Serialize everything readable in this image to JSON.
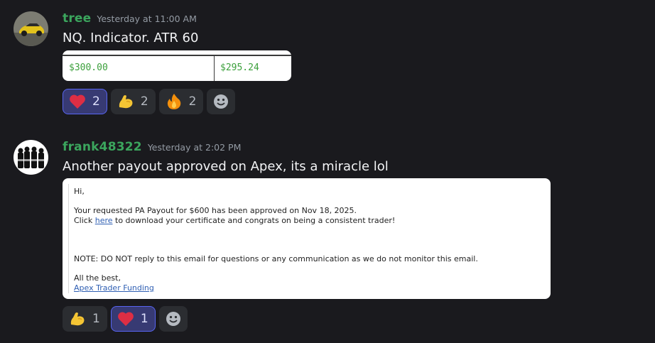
{
  "messages": [
    {
      "username": "tree",
      "timestamp": "Yesterday at 11:00 AM",
      "text": "NQ. Indicator. ATR 60",
      "sheet": {
        "cell_a": "$300.00",
        "cell_b": "$295.24"
      },
      "reactions": [
        {
          "emoji": "heart",
          "count": "2",
          "active": true
        },
        {
          "emoji": "flexed-biceps",
          "count": "2",
          "active": false
        },
        {
          "emoji": "fire",
          "count": "2",
          "active": false
        }
      ]
    },
    {
      "username": "frank48322",
      "timestamp": "Yesterday at 2:02 PM",
      "text": "Another payout approved on Apex, its a miracle lol",
      "email": {
        "greeting": "Hi,",
        "line1": "Your requested PA Payout for $600 has been approved on Nov 18, 2025.",
        "line2_pre": "Click ",
        "line2_link": "here",
        "line2_post": " to download your certificate and congrats on being a consistent trader!",
        "note": "NOTE: DO NOT reply to this email for questions or any communication as we do not monitor this email.",
        "signoff": "All the best,",
        "signature": "Apex Trader Funding"
      },
      "reactions": [
        {
          "emoji": "flexed-biceps",
          "count": "1",
          "active": false
        },
        {
          "emoji": "heart",
          "count": "1",
          "active": true
        }
      ]
    }
  ],
  "colors": {
    "background": "#1a1a1e",
    "username": "#3ba55d",
    "active_reaction_border": "#5865f2",
    "sheet_text": "#3ca03c"
  }
}
